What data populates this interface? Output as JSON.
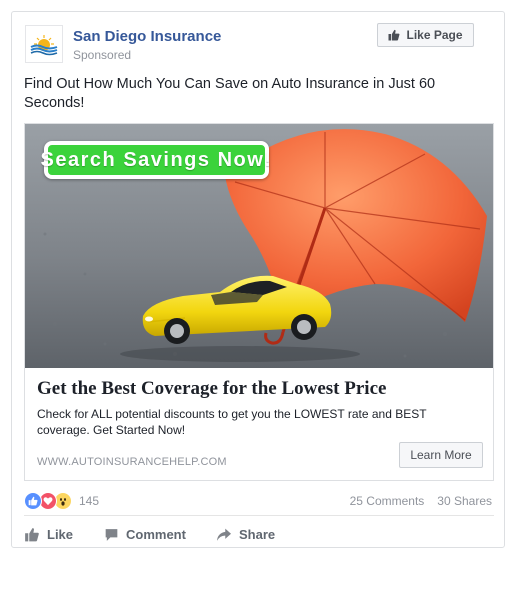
{
  "post": {
    "page_name": "San Diego Insurance",
    "sponsored_label": "Sponsored",
    "like_page_label": "Like Page",
    "text": "Find Out How Much You Can Save on Auto Insurance in Just 60 Seconds!"
  },
  "ad": {
    "image_button_text": "Search Savings Now!",
    "headline": "Get the Best Coverage for the Lowest Price",
    "description": "Check for ALL potential discounts to get you the LOWEST rate and BEST coverage. Get Started Now!",
    "domain": "WWW.AUTOINSURANCEHELP.COM",
    "cta_label": "Learn More"
  },
  "engagement": {
    "reaction_count": "145",
    "comments": "25 Comments",
    "shares": "30 Shares"
  },
  "actions": {
    "like": "Like",
    "comment": "Comment",
    "share": "Share"
  },
  "icons": {
    "page_logo": "sun-waves-logo",
    "like_page": "thumbs-up-icon",
    "reactions": [
      "like-reaction-icon",
      "love-reaction-icon",
      "wow-reaction-icon"
    ],
    "like_action": "thumbs-up-icon",
    "comment_action": "speech-bubble-icon",
    "share_action": "share-arrow-icon"
  },
  "colors": {
    "link_blue": "#365899",
    "cta_green": "#3bd33b",
    "umbrella_red": "#e8542a",
    "car_yellow": "#f2d60f"
  }
}
